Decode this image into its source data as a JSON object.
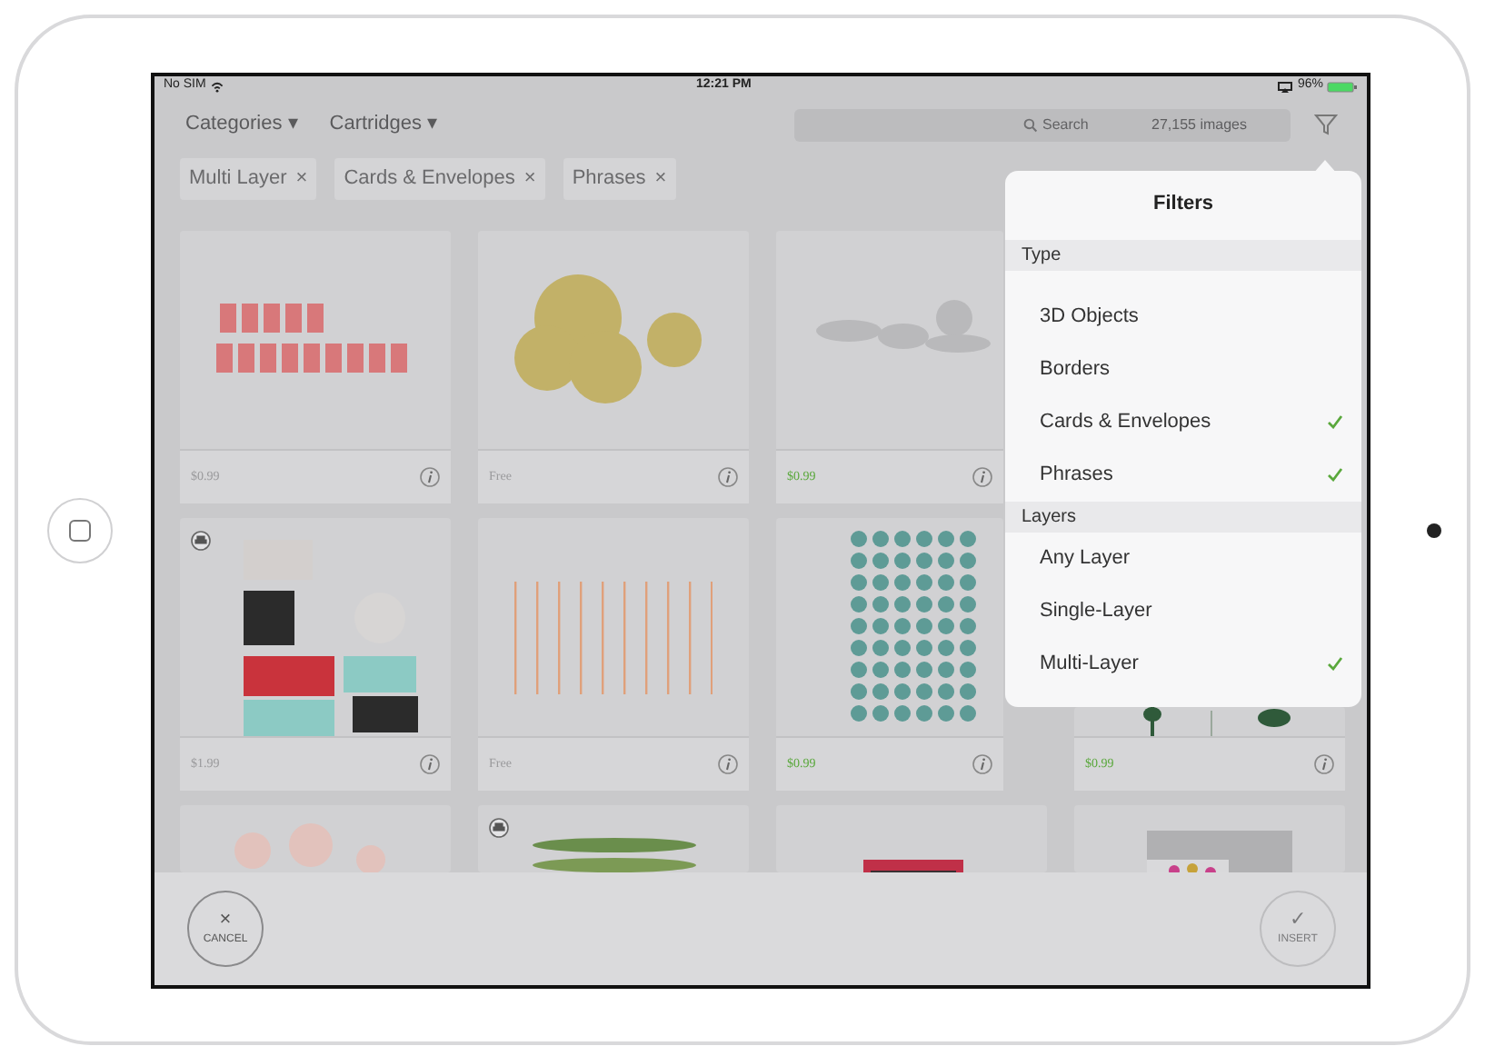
{
  "status_bar": {
    "carrier": "No SIM",
    "time": "12:21 PM",
    "battery": "96%"
  },
  "toolbar": {
    "menus": [
      {
        "label": "Categories",
        "caret": "▾"
      },
      {
        "label": "Cartridges",
        "caret": "▾"
      }
    ],
    "search": {
      "placeholder": "Search",
      "count": "27,155 images"
    }
  },
  "chips": [
    {
      "label": "Multi Layer",
      "remove": "×"
    },
    {
      "label": "Cards & Envelopes",
      "remove": "×"
    },
    {
      "label": "Phrases",
      "remove": "×"
    }
  ],
  "card_rows": [
    [
      {
        "price": "$0.99",
        "color": "#9a9a9c",
        "badge": false
      },
      {
        "price": "Free",
        "color": "#9a9a9c",
        "badge": false
      },
      {
        "price": "$0.99",
        "color": "#5aa83c",
        "badge": false
      }
    ],
    [
      {
        "price": "$1.99",
        "color": "#9a9a9c",
        "badge": true
      },
      {
        "price": "Free",
        "color": "#9a9a9c",
        "badge": false
      },
      {
        "price": "$0.99",
        "color": "#5aa83c",
        "badge": false
      },
      {
        "price": "$0.99",
        "color": "#5aa83c",
        "badge": false
      }
    ],
    [
      {
        "badge": false
      },
      {
        "badge": true
      },
      {
        "badge": false
      },
      {
        "badge": false
      }
    ]
  ],
  "popover": {
    "title": "Filters",
    "sections": [
      {
        "header": "Type",
        "items": [
          {
            "label": "3D Objects",
            "checked": false
          },
          {
            "label": "Borders",
            "checked": false
          },
          {
            "label": "Cards & Envelopes",
            "checked": true
          },
          {
            "label": "Phrases",
            "checked": true
          }
        ]
      },
      {
        "header": "Layers",
        "items": [
          {
            "label": "Any Layer",
            "checked": false
          },
          {
            "label": "Single-Layer",
            "checked": false
          },
          {
            "label": "Multi-Layer",
            "checked": true
          }
        ]
      }
    ]
  },
  "bottom_bar": {
    "cancel": {
      "icon": "×",
      "label": "CANCEL",
      "disabled": false
    },
    "insert": {
      "icon": "✓",
      "label": "INSERT",
      "disabled": true
    }
  }
}
